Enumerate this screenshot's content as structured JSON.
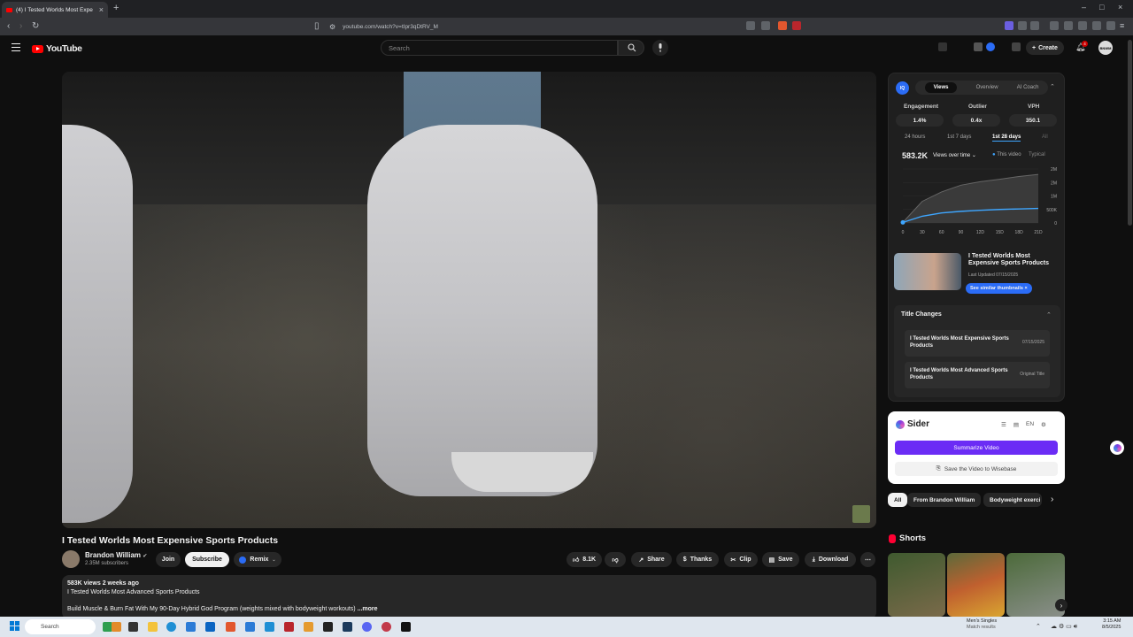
{
  "browser": {
    "tab_title": "(4) I Tested Worlds Most Expe",
    "url": "youtube.com/watch?v=tIpr3qDtRV_M"
  },
  "youtube": {
    "logo_text": "YouTube",
    "search_placeholder": "Search",
    "create_label": "Create",
    "notifications_count": "4",
    "avatar_text": "BNWM"
  },
  "video": {
    "title": "I Tested Worlds Most Expensive Sports Products",
    "channel_name": "Brandon William",
    "subscribers": "2.35M subscribers",
    "join_label": "Join",
    "subscribe_label": "Subscribe",
    "remix_label": "Remix",
    "likes": "8.1K",
    "share_label": "Share",
    "thanks_label": "Thanks",
    "clip_label": "Clip",
    "save_label": "Save",
    "download_label": "Download",
    "description": {
      "stats": "583K views  2 weeks ago",
      "line1": "I Tested Worlds Most Advanced Sports Products",
      "line2": "Build Muscle & Burn Fat With My 90-Day Hybrid God Program (weights mixed with bodyweight workouts)",
      "more": "...more"
    }
  },
  "vidiq": {
    "logo_text": "IQ",
    "tabs": [
      "Views",
      "Overview",
      "AI Coach"
    ],
    "metrics": [
      {
        "label": "Engagement",
        "value": "1.4%"
      },
      {
        "label": "Outlier",
        "value": "0.4x"
      },
      {
        "label": "VPH",
        "value": "350.1"
      }
    ],
    "ranges": [
      "24 hours",
      "1st 7 days",
      "1st 28 days",
      "All"
    ],
    "views_total": "583.2K",
    "views_dropdown": "Views over time",
    "legend_this": "This video",
    "legend_typical": "Typical",
    "thumb_title": "I Tested Worlds Most Expensive Sports Products",
    "last_updated": "Last Updated 07/15/2025",
    "similar_btn": "See similar thumbnails",
    "title_changes_header": "Title Changes",
    "title_changes": [
      {
        "title": "I Tested Worlds Most Expensive Sports Products",
        "date": "07/15/2025"
      },
      {
        "title": "I Tested Worlds Most Advanced Sports Products",
        "date": "Original Title"
      }
    ]
  },
  "chart_data": {
    "type": "area",
    "x": [
      0,
      30,
      60,
      90,
      120,
      150,
      180,
      210
    ],
    "x_tick_labels": [
      "0",
      "30",
      "60",
      "90",
      "12D",
      "15D",
      "18D",
      "21D"
    ],
    "y_tick_labels": [
      "2M",
      "2M",
      "1M",
      "500K",
      "0"
    ],
    "series": [
      {
        "name": "This video",
        "values": [
          20000,
          250000,
          370000,
          430000,
          470000,
          500000,
          520000,
          540000
        ]
      },
      {
        "name": "Typical",
        "values": [
          20000,
          800000,
          1150000,
          1400000,
          1530000,
          1620000,
          1720000,
          1800000
        ]
      }
    ],
    "ylim": [
      0,
      2000000
    ],
    "colors": {
      "this_video": "#3ea6ff",
      "typical": "#555555"
    }
  },
  "sider": {
    "name": "Sider",
    "lang": "EN",
    "summarize_label": "Summarize Video",
    "save_label": "Save the Video to Wisebase"
  },
  "chips": [
    "All",
    "From Brandon William",
    "Bodyweight exerci"
  ],
  "shorts_header": "Shorts",
  "taskbar": {
    "search_placeholder": "Search",
    "notice_title": "Men's Singles",
    "notice_sub": "Match results",
    "time": "3:15 AM",
    "date": "8/5/2025"
  }
}
